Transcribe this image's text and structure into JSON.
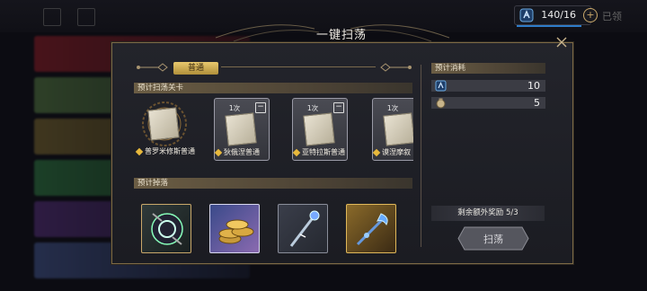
{
  "background": {
    "stamina": {
      "value": "140/16"
    },
    "top_right_label": "已领"
  },
  "dialog": {
    "title": "一键扫荡",
    "tab_label": "普通",
    "stages_header": "预计扫荡关卡",
    "stages": [
      {
        "name": "普罗米修斯普通",
        "count": "",
        "selected": false
      },
      {
        "name": "狄俄涅普通",
        "count": "1次",
        "selected": true
      },
      {
        "name": "亚特拉斯普通",
        "count": "1次",
        "selected": true
      },
      {
        "name": "谟涅摩叙",
        "count": "1次",
        "selected": true
      }
    ],
    "drops_header": "预计掉落",
    "drops": [
      {
        "icon": "relic-icon"
      },
      {
        "icon": "coins-icon"
      },
      {
        "icon": "staff-icon"
      },
      {
        "icon": "wand-icon"
      }
    ],
    "cost_header": "预计消耗",
    "costs": [
      {
        "icon": "stamina-icon",
        "value": "10"
      },
      {
        "icon": "bag-icon",
        "value": "5"
      }
    ],
    "bonus_text": "剩余额外奖励  5/3",
    "sweep_label": "扫荡"
  },
  "colors": {
    "accent_gold": "#c9a86a",
    "stamina_blue": "#2e7cc9"
  }
}
